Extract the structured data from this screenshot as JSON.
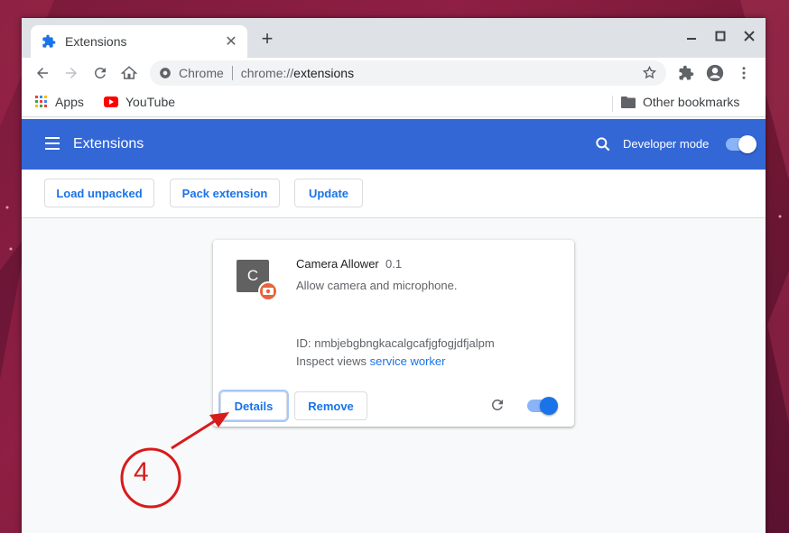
{
  "tab": {
    "title": "Extensions",
    "close": "✕",
    "new_tab": "+"
  },
  "window_controls": {
    "minimize": "—",
    "maximize": "☐",
    "close": "✕"
  },
  "omnibox": {
    "site_label": "Chrome",
    "url_prefix": "chrome://",
    "url_host": "extensions"
  },
  "bookmarks": {
    "apps_label": "Apps",
    "youtube_label": "YouTube",
    "other_label": "Other bookmarks"
  },
  "header": {
    "title": "Extensions",
    "dev_mode_label": "Developer mode",
    "dev_mode_on": true
  },
  "actions": {
    "load_unpacked": "Load unpacked",
    "pack_extension": "Pack extension",
    "update": "Update"
  },
  "extension": {
    "logo_letter": "C",
    "name": "Camera Allower",
    "version": "0.1",
    "description": "Allow camera and microphone.",
    "id_text": "ID: nmbjebgbngkacalgcafjgfogjdfjalpm",
    "inspect_label": "Inspect views",
    "inspect_link": "service worker",
    "details_label": "Details",
    "remove_label": "Remove",
    "enabled": true
  },
  "annotation": {
    "number": "4",
    "color": "#d81b1b"
  },
  "colors": {
    "header_blue": "#3367d6",
    "link_blue": "#1a73e8"
  }
}
